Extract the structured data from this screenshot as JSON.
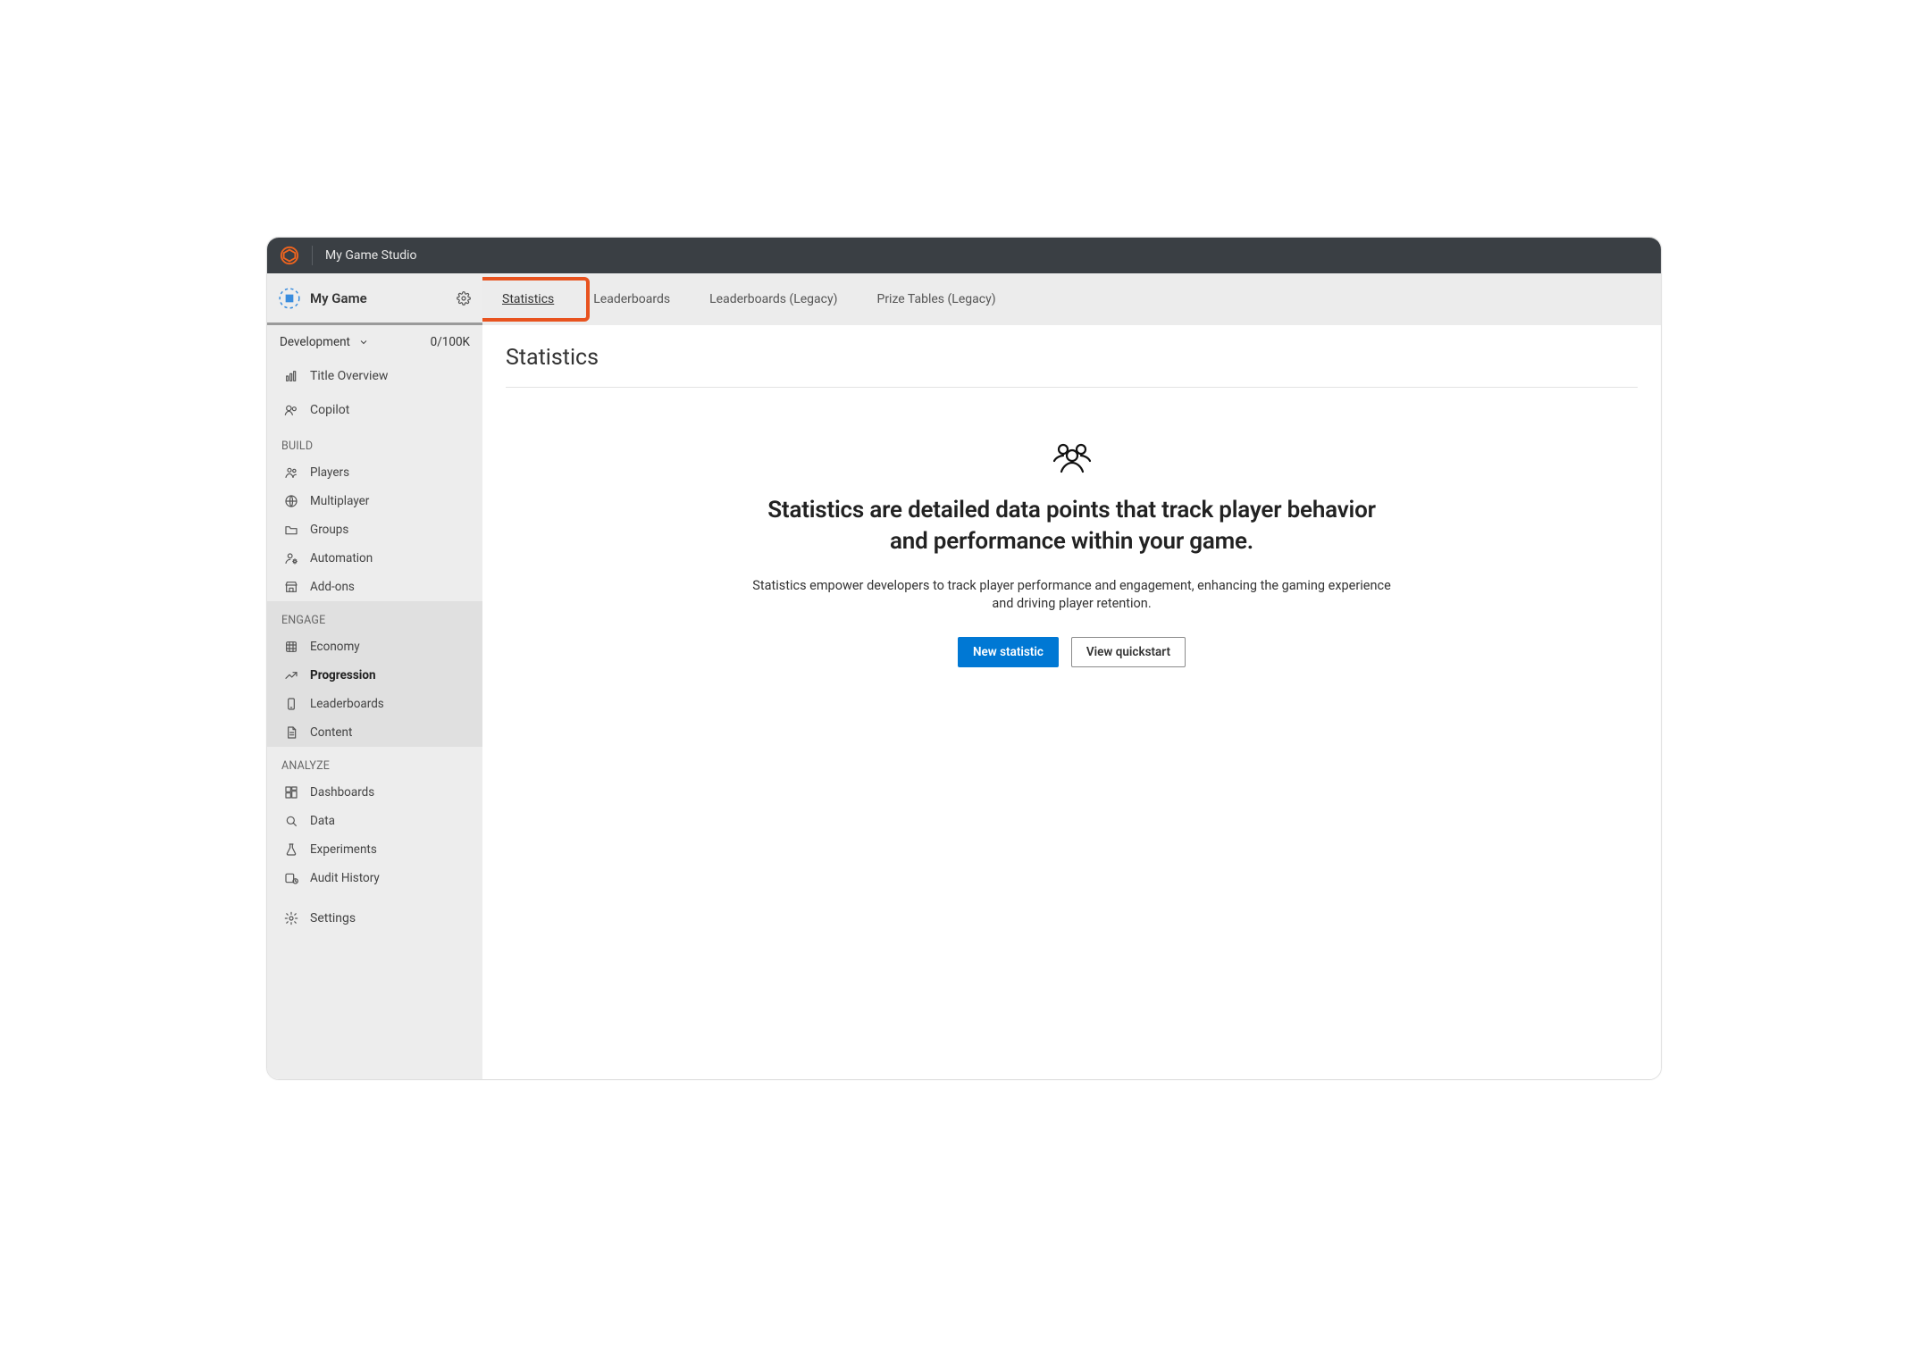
{
  "topbar": {
    "studio_name": "My Game Studio"
  },
  "sidebar": {
    "game_name": "My Game",
    "environment": "Development",
    "usage": "0/100K",
    "top_items": [
      {
        "label": "Title Overview",
        "icon": "chart-bar-icon"
      },
      {
        "label": "Copilot",
        "icon": "copilot-icon"
      }
    ],
    "sections": [
      {
        "label": "BUILD",
        "items": [
          {
            "label": "Players",
            "icon": "players-icon"
          },
          {
            "label": "Multiplayer",
            "icon": "globe-icon"
          },
          {
            "label": "Groups",
            "icon": "folder-icon"
          },
          {
            "label": "Automation",
            "icon": "person-gear-icon"
          },
          {
            "label": "Add-ons",
            "icon": "store-icon"
          }
        ]
      },
      {
        "label": "ENGAGE",
        "active": true,
        "items": [
          {
            "label": "Economy",
            "icon": "economy-icon"
          },
          {
            "label": "Progression",
            "icon": "trend-up-icon",
            "active": true
          },
          {
            "label": "Leaderboards",
            "icon": "device-icon"
          },
          {
            "label": "Content",
            "icon": "document-icon"
          }
        ]
      },
      {
        "label": "ANALYZE",
        "items": [
          {
            "label": "Dashboards",
            "icon": "dashboard-icon"
          },
          {
            "label": "Data",
            "icon": "search-icon"
          },
          {
            "label": "Experiments",
            "icon": "flask-icon"
          },
          {
            "label": "Audit History",
            "icon": "history-icon"
          }
        ]
      }
    ],
    "footer_item": {
      "label": "Settings",
      "icon": "gear-icon"
    }
  },
  "tabs": [
    {
      "label": "Statistics",
      "active": true
    },
    {
      "label": "Leaderboards"
    },
    {
      "label": "Leaderboards (Legacy)"
    },
    {
      "label": "Prize Tables (Legacy)"
    }
  ],
  "page": {
    "title": "Statistics",
    "empty": {
      "heading": "Statistics are detailed data points that track player behavior and performance within your game.",
      "subtext": "Statistics empower developers to track player performance and engagement, enhancing the gaming experience and driving player retention.",
      "primary_btn": "New statistic",
      "secondary_btn": "View quickstart"
    }
  }
}
